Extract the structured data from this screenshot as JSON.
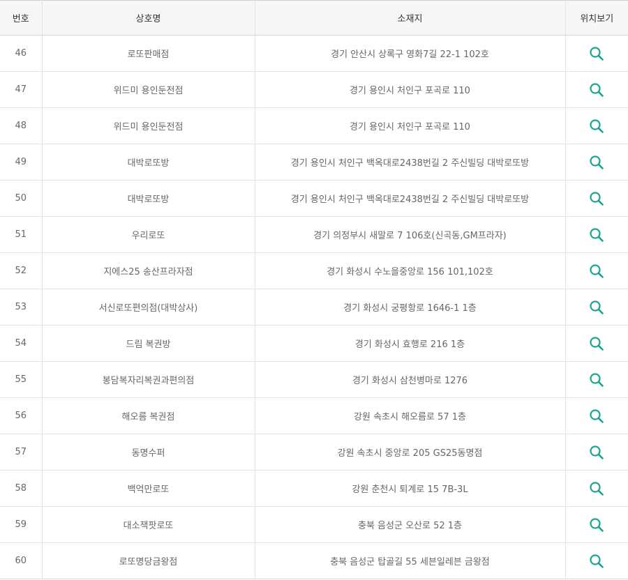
{
  "header": {
    "col_number": "번호",
    "col_name": "상호명",
    "col_address": "소재지",
    "col_location": "위치보기"
  },
  "colors": {
    "search_icon": "#1aa393"
  },
  "icon": "search-icon",
  "rows": [
    {
      "number": "46",
      "name": "로또판매점",
      "address": "경기 안산시 상록구 영화7길 22-1 102호"
    },
    {
      "number": "47",
      "name": "위드미 용인둔전점",
      "address": "경기 용인시 처인구 포곡로 110"
    },
    {
      "number": "48",
      "name": "위드미 용인둔전점",
      "address": "경기 용인시 처인구 포곡로 110"
    },
    {
      "number": "49",
      "name": "대박로또방",
      "address": "경기 용인시 처인구 백옥대로2438번길 2 주신빌딩 대박로또방"
    },
    {
      "number": "50",
      "name": "대박로또방",
      "address": "경기 용인시 처인구 백옥대로2438번길 2 주신빌딩 대박로또방"
    },
    {
      "number": "51",
      "name": "우리로또",
      "address": "경기 의정부시 새말로 7 106호(신곡동,GM프라자)"
    },
    {
      "number": "52",
      "name": "지에스25 송산프라자점",
      "address": "경기 화성시 수노을중앙로 156 101,102호"
    },
    {
      "number": "53",
      "name": "서신로또편의점(대박상사)",
      "address": "경기 화성시 궁평항로 1646-1 1층"
    },
    {
      "number": "54",
      "name": "드림 복권방",
      "address": "경기 화성시 효행로 216 1층"
    },
    {
      "number": "55",
      "name": "봉담복자리복권과편의점",
      "address": "경기 화성시 삼천병마로 1276"
    },
    {
      "number": "56",
      "name": "해오름 복권점",
      "address": "강원 속초시 해오름로 57 1층"
    },
    {
      "number": "57",
      "name": "동명수퍼",
      "address": "강원 속초시 중앙로 205 GS25동명점"
    },
    {
      "number": "58",
      "name": "백억만로또",
      "address": "강원 춘천시 퇴계로 15 7B-3L"
    },
    {
      "number": "59",
      "name": "대소잭팟로또",
      "address": "충북 음성군 오산로 52 1층"
    },
    {
      "number": "60",
      "name": "로또명당금왕점",
      "address": "충북 음성군 탑골길 55 세븐일레븐 금왕점"
    }
  ]
}
